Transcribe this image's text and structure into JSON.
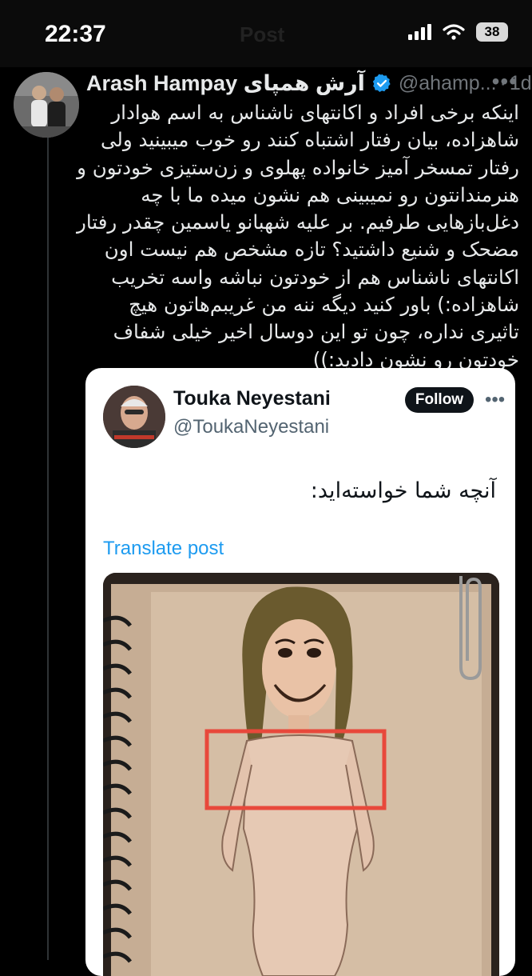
{
  "status_bar": {
    "time": "22:37",
    "ghost_title": "Post",
    "battery": "38"
  },
  "tweet": {
    "author_name": "Arash Hampay آرش همپای",
    "handle": "@ahamp...",
    "separator": "·",
    "age": "1d",
    "more": "•••",
    "lines": [
      "اینکه برخی افراد و اکانتهای ناشناس به اسم هوادار",
      "شاهزاده، بیان رفتار اشتباه کنند رو خوب میبینید ولی",
      "رفتار تمسخر آمیز خانواده پهلوی و زن‌ستیزی خودتون و",
      "هنرمندانتون رو نمیبینی هم نشون میده ما با چه",
      "دغل‌بازهایی طرفیم. بر علیه شهبانو یاسمین چقدر رفتار",
      "مضحک و شنیع داشتید؟ تازه مشخص هم نیست اون",
      "اکانتهای ناشناس هم از خودتون نباشه واسه تخریب",
      "شاهزاده:) باور کنید دیگه ننه من غریبم‌هاتون هیچ",
      "تاثیری نداره، چون تو این دوسال اخیر خیلی شفاف",
      "خودتون رو نشون دادید:))"
    ]
  },
  "embed": {
    "author_name": "Touka Neyestani",
    "handle": "@ToukaNeyestani",
    "follow_label": "Follow",
    "more": "•••",
    "text": "آنچه شما خواسته‌اید:",
    "translate_label": "Translate post"
  },
  "colors": {
    "verified": "#1d9bf0",
    "highlight_box": "#e8483b",
    "link": "#1d9bf0"
  }
}
